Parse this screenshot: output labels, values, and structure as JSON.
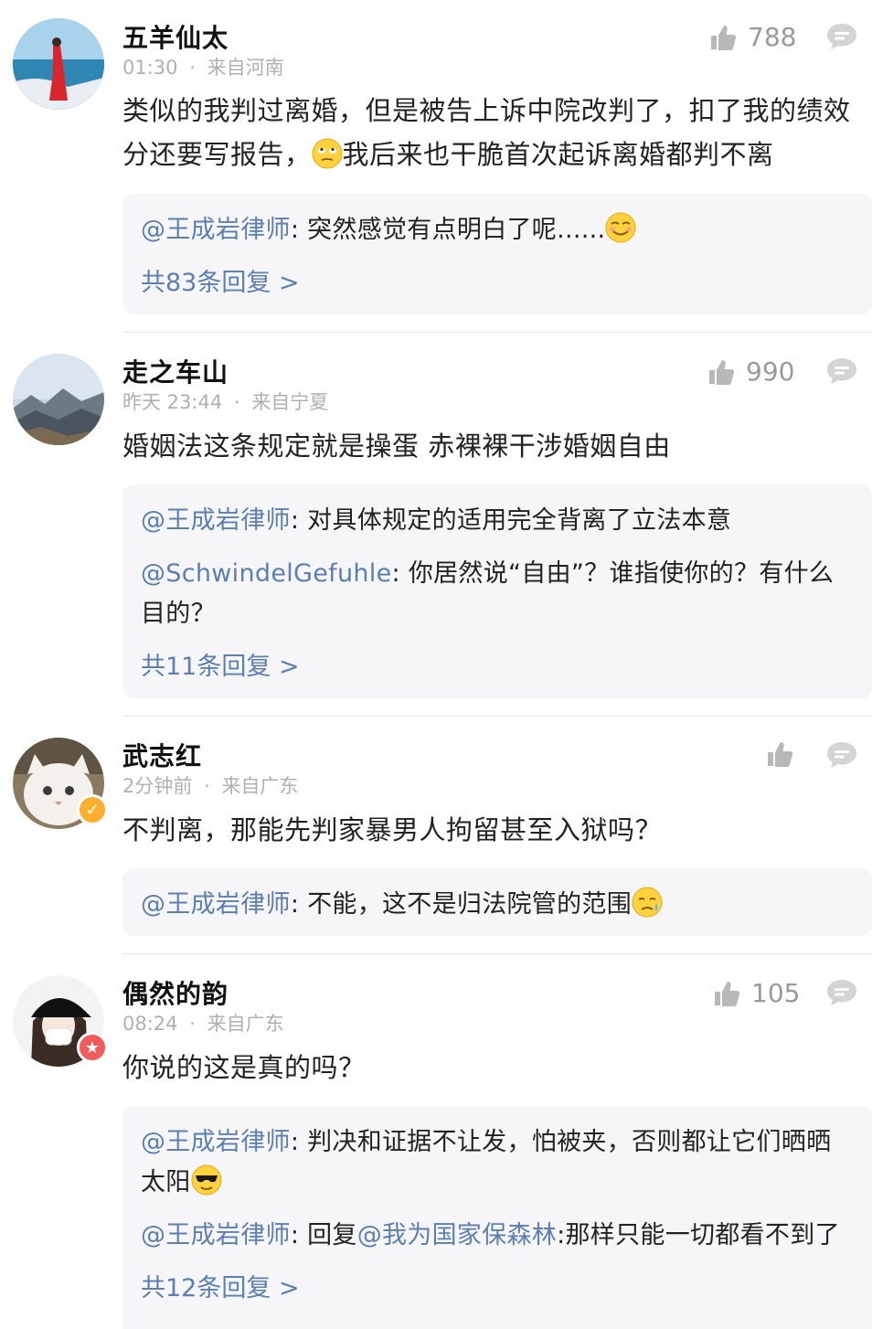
{
  "comments": [
    {
      "name": "五羊仙太",
      "time": "01:30",
      "location": "来自河南",
      "likes": "788",
      "text_part1": "类似的我判过离婚，但是被告上诉中院改判了，扣了我的绩效分还要写报告，",
      "text_part2": "我后来也干脆首次起诉离婚都判不离",
      "replies": [
        {
          "user": "@王成岩律师",
          "text": "突然感觉有点明白了呢......"
        }
      ],
      "more": "共83条回复 >"
    },
    {
      "name": "走之车山",
      "time": "昨天 23:44",
      "location": "来自宁夏",
      "likes": "990",
      "text": "婚姻法这条规定就是操蛋 赤裸裸干涉婚姻自由",
      "replies": [
        {
          "user": "@王成岩律师",
          "text": "对具体规定的适用完全背离了立法本意"
        },
        {
          "user": "@SchwindelGefuhle",
          "text": "你居然说“自由”？谁指使你的？有什么目的？"
        }
      ],
      "more": "共11条回复 >"
    },
    {
      "name": "武志红",
      "time": "2分钟前",
      "location": "来自广东",
      "likes": "",
      "text": "不判离，那能先判家暴男人拘留甚至入狱吗？",
      "replies": [
        {
          "user": "@王成岩律师",
          "text": "不能，这不是归法院管的范围"
        }
      ]
    },
    {
      "name": "偶然的韵",
      "time": "08:24",
      "location": "来自广东",
      "likes": "105",
      "text": "你说的这是真的吗？",
      "replies": [
        {
          "user": "@王成岩律师",
          "text": "判决和证据不让发，怕被夹，否则都让它们晒晒太阳"
        },
        {
          "user": "@王成岩律师",
          "text_prefix": "回复",
          "mention": "@我为国家保森林",
          "text": ":那样只能一切都看不到了"
        }
      ],
      "more": "共12条回复 >"
    }
  ],
  "separator": "·",
  "colors": {
    "link": "#5b7fb2",
    "meta": "#b0b0b0",
    "card": "#f6f6f8",
    "badge_orange": "#ffae2e",
    "badge_red": "#f35b5b"
  }
}
